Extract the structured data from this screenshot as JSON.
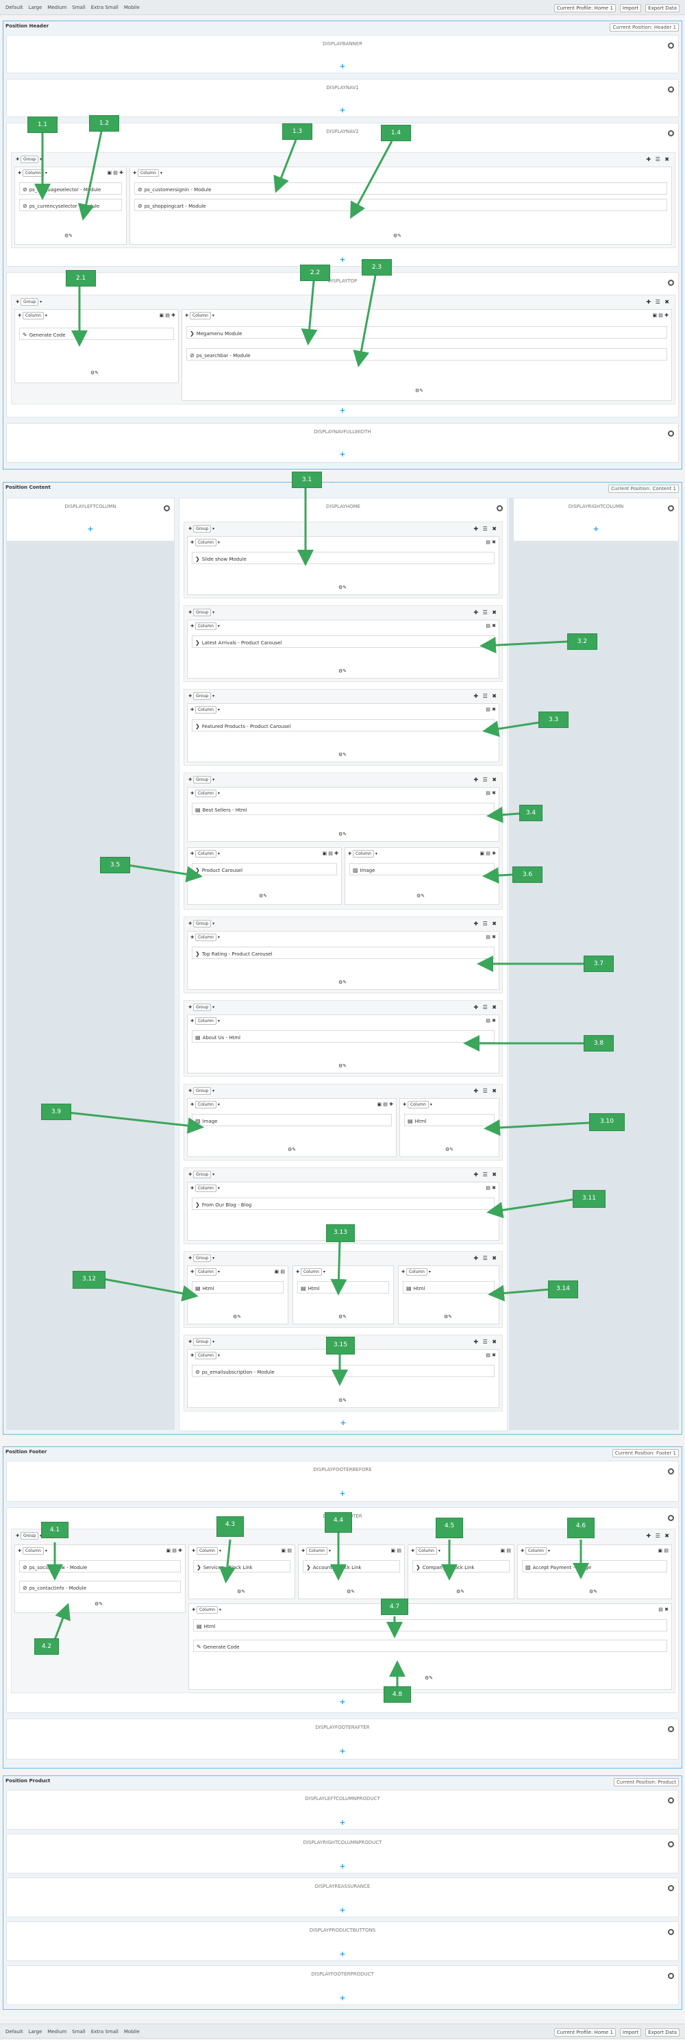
{
  "toolbar": {
    "devices": [
      "Default",
      "Large",
      "Medium",
      "Small",
      "Extra Small",
      "Mobile"
    ],
    "profile": "Current Profile: Home 1",
    "import": "Import",
    "export": "Export Data"
  },
  "sections": {
    "header": {
      "title": "Position Header",
      "select": "Current Position: Header 1"
    },
    "content": {
      "title": "Position Content",
      "select": "Current Position: Content 1"
    },
    "footer": {
      "title": "Position Footer",
      "select": "Current Position: Footer 1"
    },
    "product": {
      "title": "Position Product",
      "select": "Current Position: Product"
    }
  },
  "hooks": {
    "banner": "DISPLAYBANNER",
    "nav1": "DISPLAYNAV1",
    "nav2": "DISPLAYNAV2",
    "top": "DISPLAYTOP",
    "fullwidth": "DISPLAYNAVFULLWIDTH",
    "leftcol": "DISPLAYLEFTCOLUMN",
    "home": "DISPLAYHOME",
    "rightcol": "DISPLAYRIGHTCOLUMN",
    "footerbefore": "DISPLAYFOOTERBEFORE",
    "footer": "DISPLAYFOOTER",
    "footerafter": "DISPLAYFOOTERAFTER",
    "leftcolproduct": "DISPLAYLEFTCOLUMNPRODUCT",
    "rightcolproduct": "DISPLAYRIGHTCOLUMNPRODUCT",
    "reassurance": "DISPLAYREASSURANCE",
    "productbuttons": "DISPLAYPRODUCTBUTTONS",
    "footerproduct": "DISPLAYFOOTERPRODUCT"
  },
  "labels": {
    "group": "Group",
    "column": "Column"
  },
  "modules": {
    "lang": "ps_languageselector - Module",
    "curr": "ps_currencyselector - Module",
    "cust": "ps_customersignin - Module",
    "cart": "ps_shoppingcart - Module",
    "gen": "Generate Code",
    "mega": "Megamenu Module",
    "search": "ps_searchbar - Module",
    "slide": "Slide show Module",
    "latest": "Latest Arrivals - Product Carousel",
    "featured": "Featured Products - Product Carousel",
    "best": "Best Sellers - Html",
    "pc": "Product Carousel",
    "image": "Image",
    "top": "Top Rating - Product Carousel",
    "about": "About Us - Html",
    "image2": "Image",
    "html1": "Html",
    "blog": "From Our Blog - Blog",
    "h1": "Html",
    "h2": "Html",
    "h3": "Html",
    "email": "ps_emailsubscription - Module",
    "social": "ps_socialfollow - Module",
    "contact": "ps_contactinfo - Module",
    "services": "Services - Block Link",
    "account": "Account - Block Link",
    "company": "Company - Block Link",
    "payment": "Accept Payment - Image",
    "fhtml": "Html",
    "fgen": "Generate Code"
  },
  "annotations": [
    "1.1",
    "1.2",
    "1.3",
    "1.4",
    "2.1",
    "2.2",
    "2.3",
    "3.1",
    "3.2",
    "3.3",
    "3.4",
    "3.5",
    "3.6",
    "3.7",
    "3.8",
    "3.9",
    "3.10",
    "3.11",
    "3.12",
    "3.13",
    "3.14",
    "3.15",
    "4.1",
    "4.2",
    "4.3",
    "4.4",
    "4.5",
    "4.6",
    "4.7",
    "4.8"
  ],
  "colors": {
    "accent": "#2aa0e6",
    "annotation": "#3aa65a",
    "border": "#74b9e2"
  }
}
